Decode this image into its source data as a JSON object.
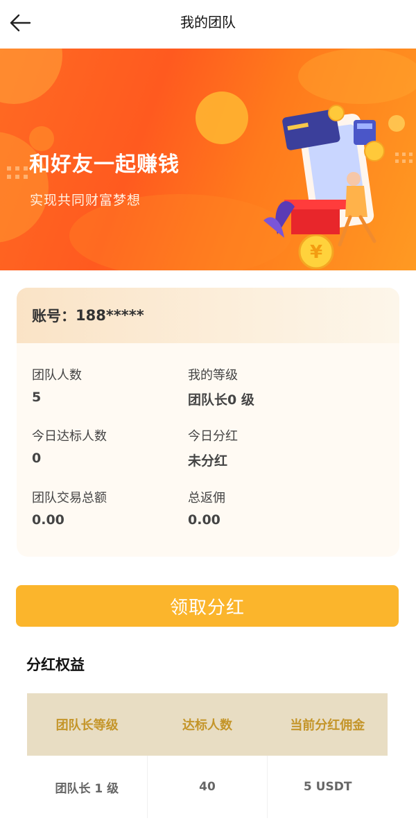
{
  "header": {
    "title": "我的团队",
    "back_icon": "arrow-left-icon"
  },
  "banner": {
    "title": "和好友一起赚钱",
    "subtitle": "实现共同财富梦想",
    "colors": {
      "primary": "#ff5a1f",
      "secondary": "#ff9a22"
    }
  },
  "account": {
    "label": "账号：",
    "value": "188*****"
  },
  "stats": [
    {
      "label": "团队人数",
      "value": "5"
    },
    {
      "label": "我的等级",
      "value": "团队长0 级"
    },
    {
      "label": "今日达标人数",
      "value": "0"
    },
    {
      "label": "今日分红",
      "value": "未分红"
    },
    {
      "label": "团队交易总额",
      "value": "0.00"
    },
    {
      "label": "总返佣",
      "value": "0.00"
    }
  ],
  "claim_button": {
    "label": "领取分红",
    "color": "#fbb52c"
  },
  "benefits": {
    "title": "分红权益",
    "headers": [
      "团队长等级",
      "达标人数",
      "当前分红佣金"
    ],
    "rows": [
      [
        "团队长 1 级",
        "40",
        "5 USDT"
      ]
    ]
  }
}
